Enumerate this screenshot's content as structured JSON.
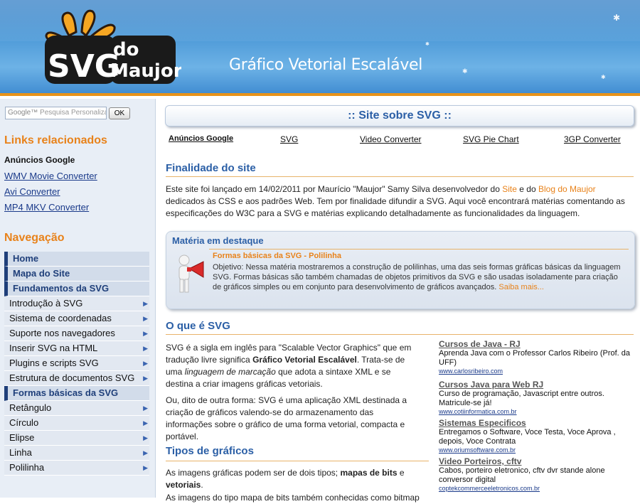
{
  "header": {
    "logo_line1": "SVG",
    "logo_line2": "do",
    "logo_line3": "Maujor",
    "tagline": "Gráfico Vetorial Escalável"
  },
  "sidebar": {
    "search_placeholder": "Pesquisa Personalizada",
    "search_brand": "Google™",
    "ok_label": "OK",
    "links_heading": "Links relacionados",
    "links_ads_label": "Anúncios Google",
    "links": [
      "WMV Movie Converter",
      "Avi Converter",
      "MP4 MKV Converter"
    ],
    "nav_heading": "Navegação",
    "nav": [
      {
        "label": "Home",
        "type": "sec"
      },
      {
        "label": "Mapa do Site",
        "type": "sec"
      },
      {
        "label": "Fundamentos da SVG",
        "type": "sec"
      },
      {
        "label": "Introdução à SVG",
        "type": "sub"
      },
      {
        "label": "Sistema de coordenadas",
        "type": "sub"
      },
      {
        "label": "Suporte nos navegadores",
        "type": "sub"
      },
      {
        "label": "Inserir SVG na HTML",
        "type": "sub"
      },
      {
        "label": "Plugins e scripts SVG",
        "type": "sub"
      },
      {
        "label": "Estrutura de documentos SVG",
        "type": "sub"
      },
      {
        "label": "Formas básicas da SVG",
        "type": "sec"
      },
      {
        "label": "Retângulo",
        "type": "sub"
      },
      {
        "label": "Círculo",
        "type": "sub"
      },
      {
        "label": "Elipse",
        "type": "sub"
      },
      {
        "label": "Linha",
        "type": "sub"
      },
      {
        "label": "Polilinha",
        "type": "sub"
      }
    ]
  },
  "main": {
    "page_title": ":: Site sobre SVG ::",
    "ads_label": "Anúncios Google",
    "ad_links": [
      "SVG",
      "Video Converter",
      "SVG Pie Chart",
      "3GP Converter"
    ],
    "section1_title": "Finalidade do site",
    "section1_p1": "Este site foi lançado em 14/02/2011 por Maurício \"Maujor\" Samy Silva desenvolvedor do",
    "section1_site_link": "Site",
    "section1_and": "e do",
    "section1_blog_link": "Blog do Maujor",
    "section1_p2": "dedicados às CSS e aos padrões Web. Tem por finalidade difundir a SVG. Aqui você encontrará matérias comentando as especificações do W3C para a SVG e matérias explicando detalhadamente as funcionalidades da linguagem.",
    "feature_heading": "Matéria em destaque",
    "feature_title": "Formas básicas da SVG - Polilinha",
    "feature_text": "Objetivo: Nessa matéria mostraremos a construção de polilinhas, uma das seis formas gráficas básicas da linguagem SVG. Formas básicas são também chamadas de objetos primitivos da SVG e são usadas isoladamente para criação de gráficos simples ou em conjunto para desenvolvimento de gráficos avançados.",
    "feature_more": "Saiba mais...",
    "section2_title": "O que é SVG",
    "section2_p1a": "SVG é a sigla em inglês para \"Scalable Vector Graphics\" que em tradução livre significa",
    "section2_p1b": "Gráfico Vetorial Escalável",
    "section2_p1c": ". Trata-se de uma",
    "section2_p1d": "linguagem de marcação",
    "section2_p1e": "que adota a sintaxe XML e se destina a criar imagens gráficas vetoriais.",
    "section2_p2": "Ou, dito de outra forma: SVG é uma aplicação XML destinada a criação de gráficos valendo-se do armazenamento das informações sobre o gráfico de uma forma vetorial, compacta e portável.",
    "section3_title": "Tipos de gráficos",
    "section3_p1a": "As imagens gráficas podem ser de dois tipos;",
    "section3_p1b": "mapas de bits",
    "section3_p1c": "e",
    "section3_p1d": "vetoriais",
    "section3_p1e": ".",
    "section3_p2": "As imagens do tipo mapa de bits também conhecidas como bitmap",
    "ads": [
      {
        "title": "Cursos de Java - RJ",
        "desc": "Aprenda Java com o Professor Carlos Ribeiro (Prof. da UFF)",
        "url": "www.carlosribeiro.com"
      },
      {
        "title": "Cursos Java para Web RJ",
        "desc": "Curso de programação, Javascript entre outros. Matricule-se já!",
        "url": "www.cotiinformatica.com.br"
      },
      {
        "title": "Sistemas Especificos",
        "desc": "Entregamos o Software, Voce Testa, Voce Aprova , depois, Voce Contrata",
        "url": "www.oriumsoftware.com.br"
      },
      {
        "title": "Video Porteiros, cftv",
        "desc": "Cabos, porteiro eletronico, cftv dvr stande alone conversor digital",
        "url": "coptekcommerceeletronicos.com.br"
      }
    ]
  }
}
